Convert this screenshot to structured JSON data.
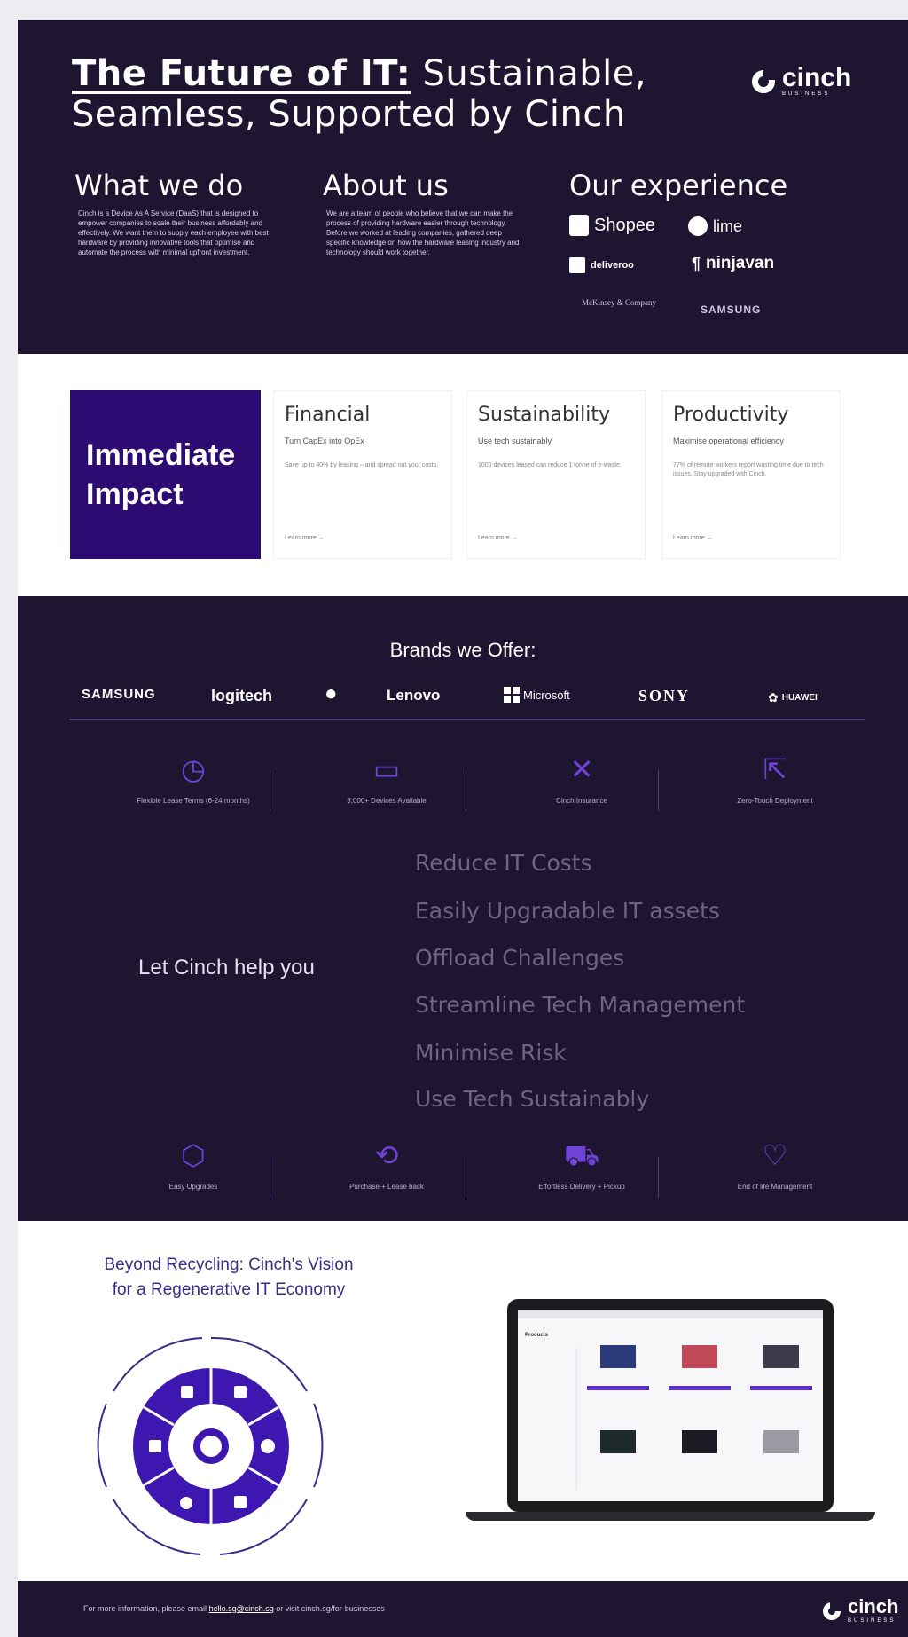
{
  "hero": {
    "title_strong": "The Future of IT:",
    "title_rest": "Sustainable, Seamless, Supported by Cinch",
    "logo_word": "cinch",
    "logo_sub": "BUSINESS",
    "what_heading": "What we do",
    "what_text": "Cinch is a Device As A Service (DaaS) that is designed to empower companies to scale their business affordably and effectively. We want them to supply each employee with best hardware by providing innovative tools that optimise and automate the process with minimal upfront investment.",
    "about_heading": "About us",
    "about_text": "We are a team of people who believe that we can make the process of providing hardware easier through technology. Before we worked at leading companies, gathered deep specific knowledge on how the hardware leasing industry and technology should work together.",
    "experience_heading": "Our experience",
    "experience_brands": [
      "Shopee",
      "lime",
      "deliveroo",
      "ninjavan",
      "McKinsey & Company",
      "SAMSUNG"
    ]
  },
  "impact": {
    "title": "Immediate Impact",
    "cards": [
      {
        "title": "Financial",
        "subtitle": "Turn CapEx into OpEx",
        "desc": "Save up to 40% by leasing – and spread out your costs.",
        "link": "Learn more →"
      },
      {
        "title": "Sustainability",
        "subtitle": "Use tech sustainably",
        "desc": "1000 devices leased can reduce 1 tonne of e-waste.",
        "link": "Learn more →"
      },
      {
        "title": "Productivity",
        "subtitle": "Maximise operational efficiency",
        "desc": "77% of remote workers report wasting time due to tech issues. Stay upgraded with Cinch.",
        "link": "Learn more →"
      }
    ]
  },
  "brands": {
    "title": "Brands we Offer:",
    "logos": [
      "SAMSUNG",
      "logitech",
      "",
      "Lenovo",
      "Microsoft",
      "SONY",
      "HUAWEI"
    ],
    "features_top": [
      {
        "icon": "clock-icon",
        "label": "Flexible Lease Terms (6-24 months)"
      },
      {
        "icon": "monitor-icon",
        "label": "3,000+ Devices Available"
      },
      {
        "icon": "tools-icon",
        "label": "Cinch Insurance"
      },
      {
        "icon": "cursor-icon",
        "label": "Zero-Touch Deployment"
      }
    ],
    "help_text": "Let Cinch help you",
    "benefits": [
      "Reduce IT Costs",
      "Easily Upgradable IT assets",
      "Offload Challenges",
      "Streamline Tech Management",
      "Minimise Risk",
      "Use Tech Sustainably"
    ],
    "features_bottom": [
      {
        "icon": "upgrade-icon",
        "label": "Easy Upgrades"
      },
      {
        "icon": "buyback-icon",
        "label": "Purchase + Lease back"
      },
      {
        "icon": "truck-icon",
        "label": "Effortless Delivery + Pickup"
      },
      {
        "icon": "heart-icon",
        "label": "End of life Management"
      }
    ]
  },
  "beyond": {
    "title_line1": "Beyond Recycling: Cinch's Vision",
    "title_line2": "for a Regenerative IT Economy",
    "laptop_heading": "Products"
  },
  "footer": {
    "text_before": "For more information, please email",
    "email": "hello.sg@cinch.sg",
    "text_after": "or visit cinch.sg/for-businesses"
  }
}
